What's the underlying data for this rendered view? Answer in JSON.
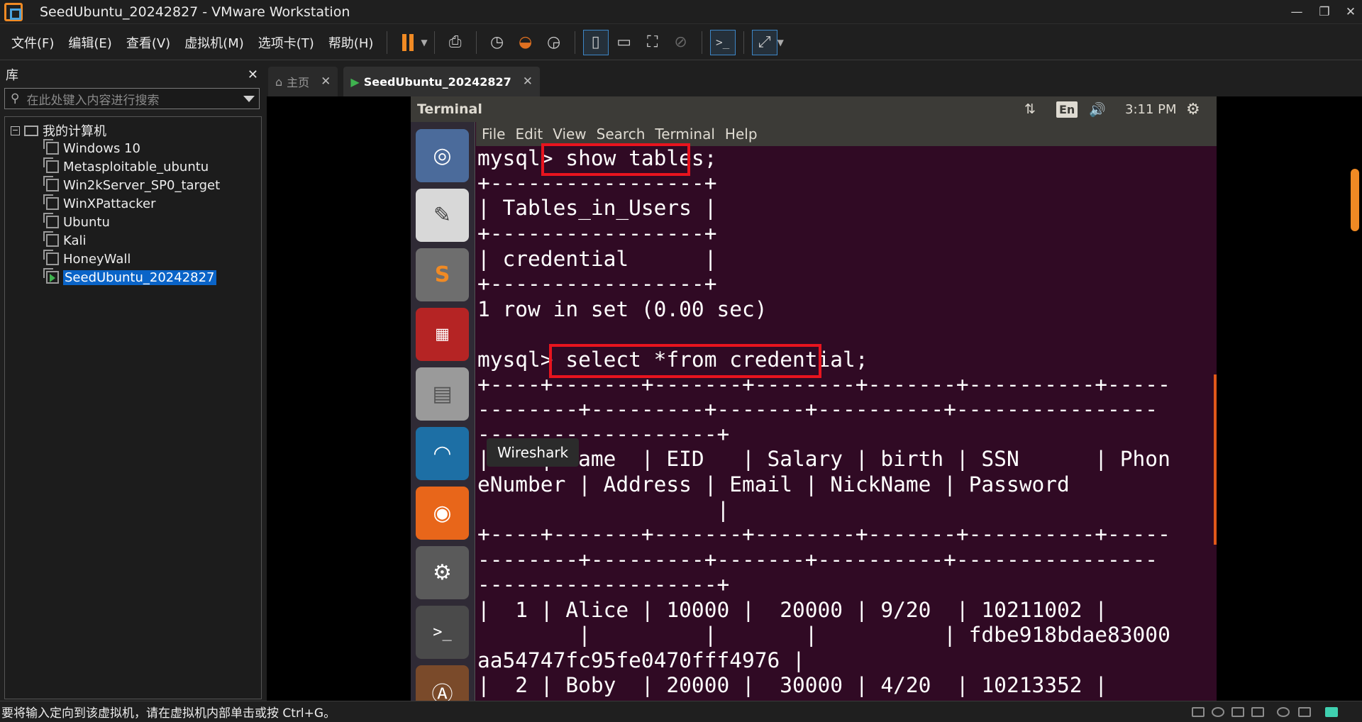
{
  "window": {
    "title": "SeedUbuntu_20242827 - VMware Workstation",
    "controls": [
      "minimize-icon",
      "restore-icon",
      "close-icon"
    ]
  },
  "menu": {
    "items": [
      "文件(F)",
      "编辑(E)",
      "查看(V)",
      "虚拟机(M)",
      "选项卡(T)",
      "帮助(H)"
    ]
  },
  "library": {
    "title": "库",
    "close": "✕",
    "search_placeholder": "在此处键入内容进行搜索",
    "root": "我的计算机",
    "root_toggle": "−",
    "vms": [
      "Windows 10",
      "Metasploitable_ubuntu",
      "Win2kServer_SP0_target",
      "WinXPattacker",
      "Ubuntu",
      "Kali",
      "HoneyWall",
      "SeedUbuntu_20242827"
    ],
    "selected_index": 7
  },
  "tabs": [
    {
      "label": "主页",
      "close": "✕"
    },
    {
      "label": "SeedUbuntu_20242827",
      "close": "✕"
    }
  ],
  "ubuntu": {
    "window_title": "Terminal",
    "clock": "3:11 PM",
    "lang": "En",
    "menu": [
      "File",
      "Edit",
      "View",
      "Search",
      "Terminal",
      "Help"
    ],
    "tooltip": "Wireshark",
    "terminal_lines": [
      "mysql> show tables;",
      "+-----------------+",
      "| Tables_in_Users |",
      "+-----------------+",
      "| credential      |",
      "+-----------------+",
      "1 row in set (0.00 sec)",
      "",
      "mysql> select *from credential;",
      "+----+-------+-------+--------+-------+----------+-----",
      "--------+---------+-------+----------+----------------",
      "-------------------+",
      "| ID | Name  | EID   | Salary | birth | SSN      | Phon",
      "eNumber | Address | Email | NickName | Password",
      "                   |",
      "+----+-------+-------+--------+-------+----------+-----",
      "--------+---------+-------+----------+----------------",
      "-------------------+",
      "|  1 | Alice | 10000 |  20000 | 9/20  | 10211002 |",
      "        |         |       |          | fdbe918bdae83000",
      "aa54747fc95fe0470fff4976 |",
      "|  2 | Boby  | 20000 |  30000 | 4/20  | 10213352 |"
    ]
  },
  "status": {
    "text": "要将输入定向到该虚拟机，请在虚拟机内部单击或按 Ctrl+G。"
  },
  "colors": {
    "accent": "#f08a24",
    "selection": "#0a64c8",
    "terminal_bg": "#300a24",
    "highlight_box": "#e8141e"
  }
}
